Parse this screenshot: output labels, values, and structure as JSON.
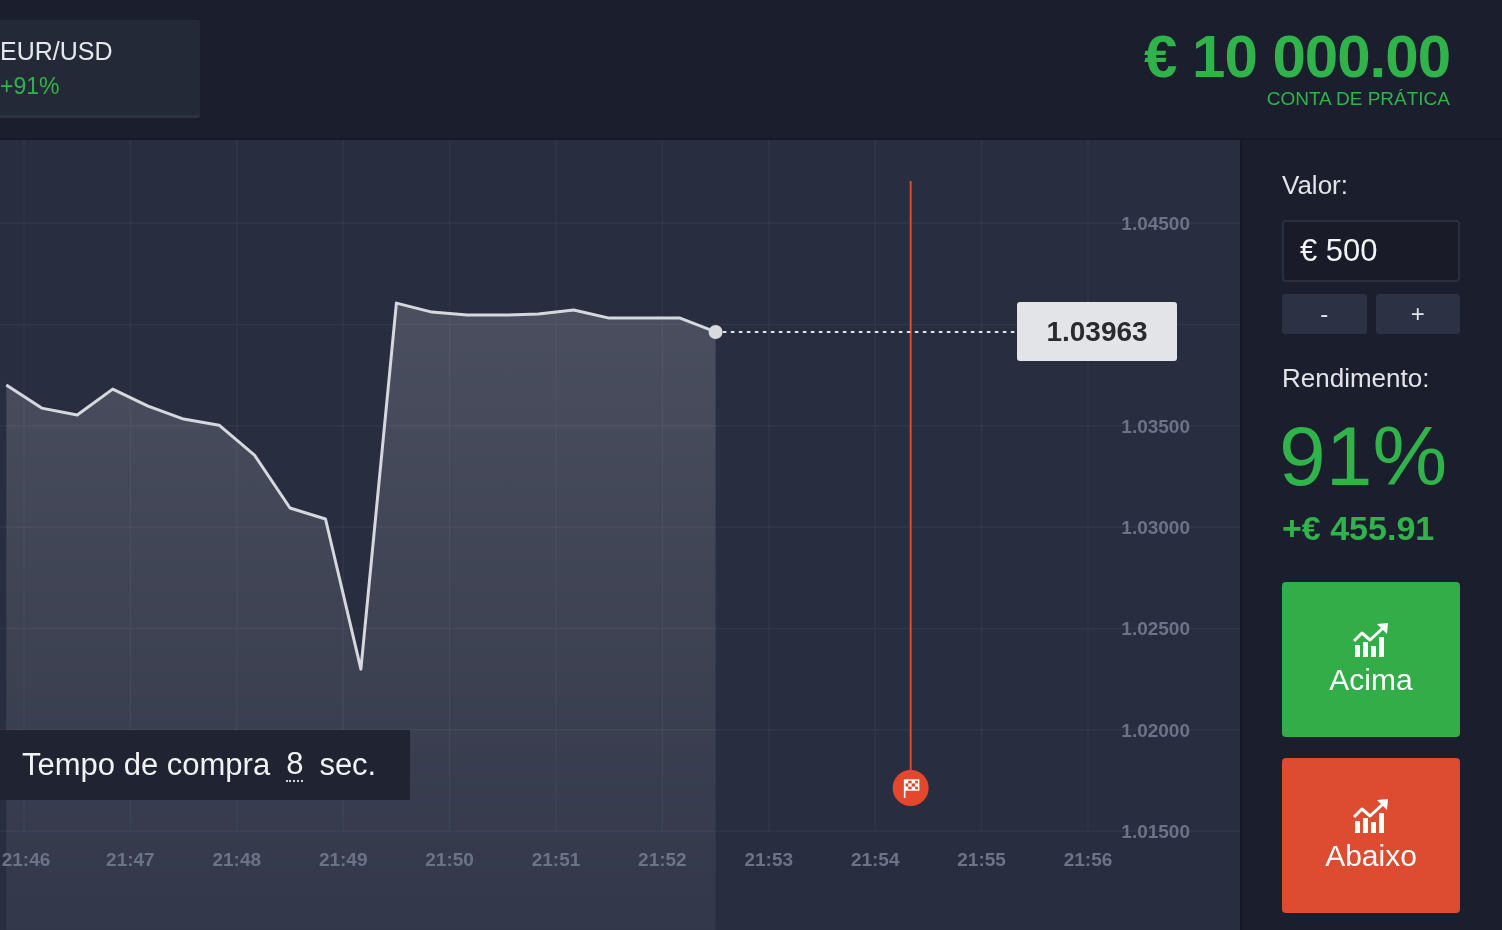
{
  "asset": {
    "name": "EUR/USD",
    "payout": "+91%"
  },
  "balance": {
    "amount": "€ 10 000.00",
    "account_type": "CONTA DE PRÁTICA"
  },
  "chart": {
    "chart_data": {
      "type": "area",
      "categories": [
        null,
        "21:46",
        null,
        null,
        null,
        null,
        null,
        "21:47",
        null,
        null,
        null,
        null,
        null,
        "21:48",
        null,
        null,
        null,
        null,
        null,
        "21:49",
        null,
        null,
        null,
        null,
        null,
        "21:50",
        null,
        null,
        null,
        null,
        null,
        "21:51",
        null,
        null,
        null,
        null,
        null,
        "21:52",
        null,
        null,
        null,
        null,
        null,
        "21:53",
        null,
        null,
        null,
        null,
        null,
        "21:54",
        null,
        null,
        null,
        null,
        null,
        "21:55",
        null,
        null,
        null,
        null,
        null,
        "21:56",
        null,
        null,
        null,
        null,
        null,
        null,
        null,
        null
      ],
      "values": [
        1.03701,
        null,
        1.03587,
        null,
        1.03553,
        null,
        1.03681,
        null,
        1.03597,
        null,
        1.03533,
        null,
        1.03503,
        null,
        1.03355,
        null,
        1.03094,
        null,
        1.0304,
        null,
        1.02299,
        null,
        1.04105,
        null,
        1.04061,
        null,
        1.04046,
        null,
        1.04046,
        null,
        1.04051,
        null,
        1.04071,
        null,
        1.04031,
        null,
        1.04031,
        null,
        1.04031,
        null,
        1.03963,
        null,
        null,
        null,
        null,
        null,
        null,
        null,
        null,
        null,
        null,
        null,
        null,
        null,
        null,
        null,
        null,
        null,
        null,
        null,
        null,
        null,
        null,
        null,
        null,
        null,
        null,
        null,
        null,
        null
      ],
      "ylim": [
        1.01012,
        1.0491
      ],
      "yticks": [
        {
          "value": 1.015,
          "label": "1.01500"
        },
        {
          "value": 1.02,
          "label": "1.02000"
        },
        {
          "value": 1.025,
          "label": "1.02500"
        },
        {
          "value": 1.03,
          "label": "1.03000"
        },
        {
          "value": 1.035,
          "label": "1.03500"
        },
        {
          "value": 1.045,
          "label": "1.04500"
        }
      ],
      "grid": true,
      "annotations": [
        "1.03963"
      ]
    },
    "purchase_time": {
      "label": "Tempo de compra",
      "value": "8",
      "unit": "sec."
    }
  },
  "trade_panel": {
    "amount_label": "Valor:",
    "amount_value": "€ 500",
    "stepper": [
      "-",
      "+"
    ],
    "return_label": "Rendimento:",
    "return_percent": "91%",
    "return_amount": "+€ 455.91",
    "actions": [
      {
        "label": "Acima",
        "color": "#32ad48"
      },
      {
        "label": "Abaixo",
        "color": "#dd4b30"
      }
    ]
  }
}
